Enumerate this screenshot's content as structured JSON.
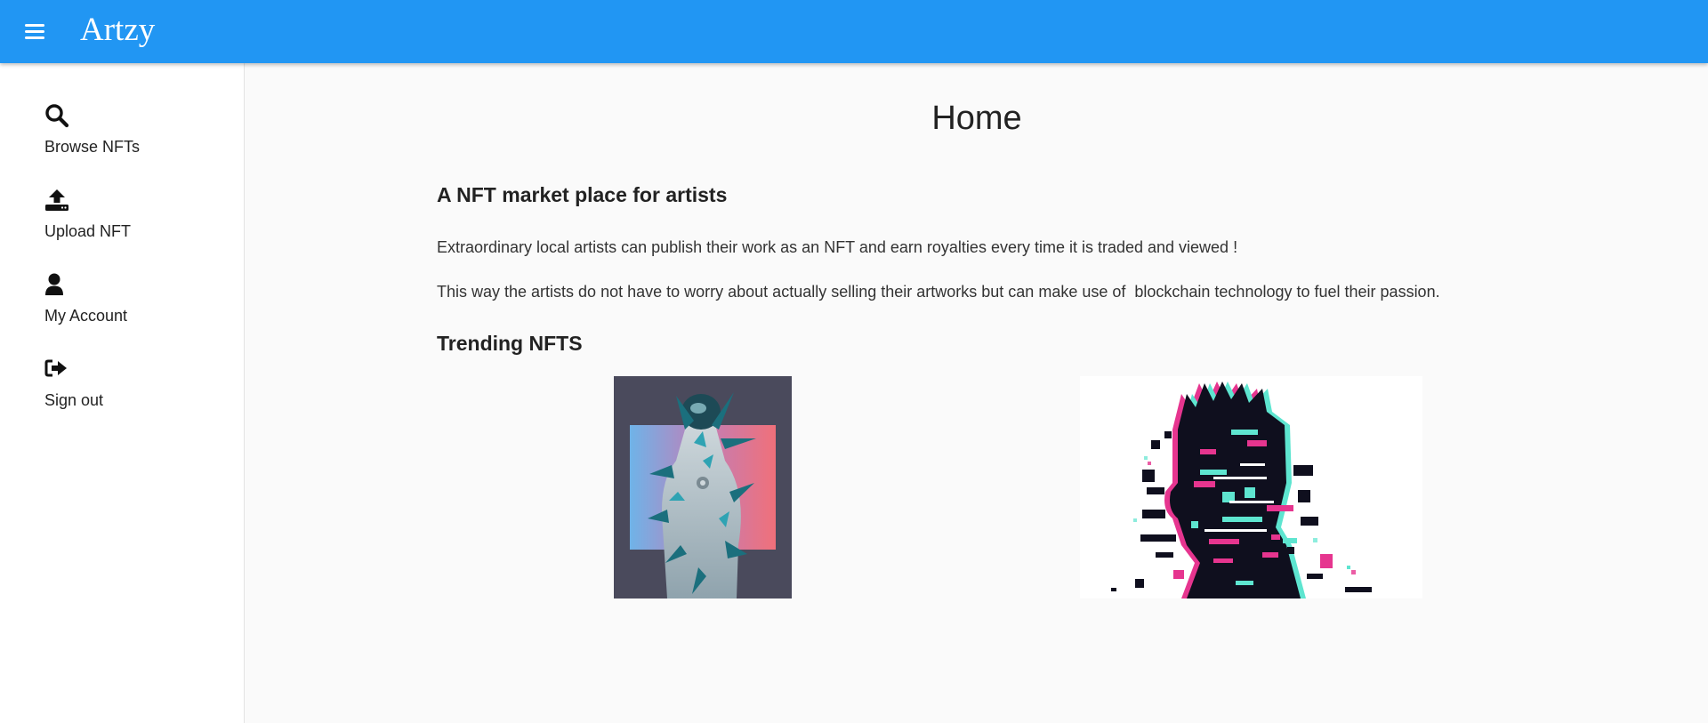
{
  "header": {
    "brand": "Artzy",
    "menu_icon": "menu-icon",
    "color": "#2196f3"
  },
  "sidebar": {
    "items": [
      {
        "label": "Browse NFTs",
        "icon": "search-icon"
      },
      {
        "label": "Upload NFT",
        "icon": "upload-icon"
      },
      {
        "label": "My Account",
        "icon": "user-icon"
      },
      {
        "label": "Sign out",
        "icon": "sign-out-icon"
      }
    ]
  },
  "main": {
    "title": "Home",
    "subtitle": "A NFT market place for artists",
    "paragraphs": [
      "Extraordinary local artists can publish their work as an NFT and earn royalties every time it is traded and viewed !",
      "This way the artists do not have to worry about actually selling their artworks but can make use of  blockchain technology to fuel their passion."
    ],
    "trending_heading": "Trending NFTS",
    "trending": [
      {
        "name": "crystal-astronaut-artwork"
      },
      {
        "name": "glitch-portrait-artwork"
      }
    ]
  }
}
